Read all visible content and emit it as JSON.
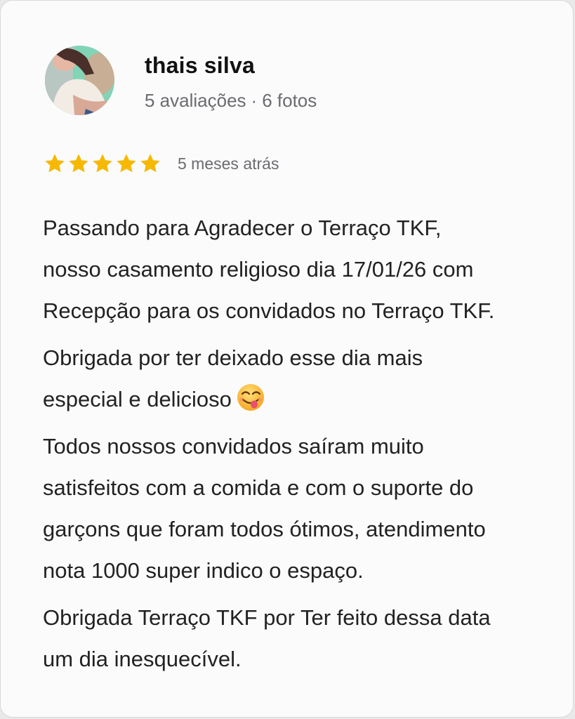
{
  "review": {
    "author": {
      "name": "thais silva",
      "reviews_count": "5 avaliações",
      "separator": "·",
      "photos_count": "6 fotos"
    },
    "rating": {
      "stars": 5,
      "max_stars": 5,
      "star_color": "#f6b800",
      "time_ago": "5 meses atrás"
    },
    "paragraphs": [
      {
        "lines": [
          "Passando para Agradecer o Terraço TKF,",
          "nosso casamento religioso dia 17/01/26 com",
          "Recepção para os convidados no Terraço TKF."
        ]
      },
      {
        "lines": [
          "Obrigada por ter deixado esse dia mais",
          "especial e delicioso"
        ],
        "trailing_emoji": "face-savoring-food-emoji"
      },
      {
        "lines": [
          "Todos nossos convidados saíram muito",
          "satisfeitos com a comida e com o suporte do",
          "garçons que foram todos ótimos, atendimento",
          "nota 1000 super indico o espaço."
        ]
      },
      {
        "lines": [
          "Obrigada Terraço TKF por Ter feito dessa data",
          "um dia inesquecível."
        ]
      }
    ]
  },
  "colors": {
    "card_background": "#fbfbfc",
    "text_primary": "#111111",
    "text_secondary": "#6b6b70"
  }
}
